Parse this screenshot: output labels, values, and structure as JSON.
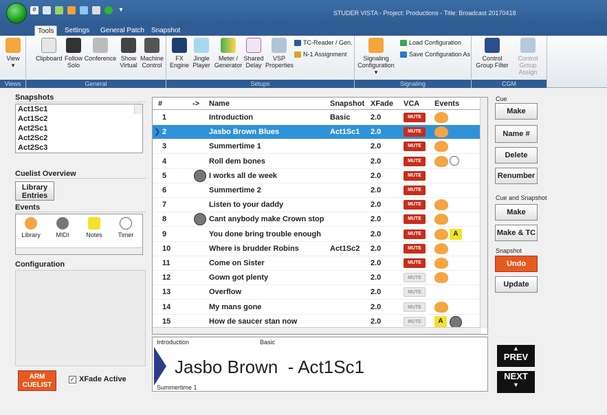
{
  "window": {
    "title": "STUDER VISTA - Project: Productions - Title: Broadcast 20170418"
  },
  "tabs": [
    "Tools",
    "Settings",
    "General Patch",
    "Snapshot"
  ],
  "ribbon": {
    "groups": [
      "Views",
      "General",
      "Setups",
      "Signaling",
      "CGM"
    ],
    "view": "View",
    "clipboard": "Clipboard",
    "follow_solo": "Follow Solo",
    "conference": "Conference",
    "show_virtual": "Show Virtual",
    "machine_control": "Machine Control",
    "fx_engine": "FX Engine",
    "jingle_player": "Jingle Player",
    "meter_generator": "Meter / Generator",
    "shared_delay": "Shared Delay",
    "vsp_properties": "VSP Properties",
    "tc_reader": "TC-Reader / Gen.",
    "n1_assignment": "N-1 Assignment",
    "signaling_configuration": "Signaling Configuration",
    "load_configuration": "Load Configuration",
    "save_configuration_as": "Save Configuration As",
    "control_group_filter": "Control Group Filter",
    "control_group_assign": "Control Group Assign"
  },
  "left": {
    "snapshots_title": "Snapshots",
    "snapshots": [
      "Act1Sc1",
      "Act1Sc2",
      "Act2Sc1",
      "Act2Sc2",
      "Act2Sc3"
    ],
    "cuelist_overview_title": "Cuelist Overview",
    "library_entries": "Library Entries",
    "events_title": "Events",
    "events": [
      {
        "label": "Library",
        "icon": "mask-icon"
      },
      {
        "label": "MIDI",
        "icon": "midi-icon"
      },
      {
        "label": "Notes",
        "icon": "notes-icon"
      },
      {
        "label": "Timer",
        "icon": "timer-icon"
      }
    ],
    "configuration_title": "Configuration",
    "arm_cuelist": "ARM CUELIST",
    "xfade_active": "XFade Active"
  },
  "grid": {
    "headers": {
      "num": "#",
      "arrow": "->",
      "name": "Name",
      "snapshot": "Snapshot",
      "xfade": "XFade",
      "vca": "VCA",
      "events": "Events"
    },
    "vca_text": "MUTE",
    "rows": [
      {
        "num": "1",
        "name": "Introduction",
        "snapshot": "Basic",
        "xfade": "2.0",
        "vca": "on",
        "events": [
          "mask"
        ],
        "midi_before": false,
        "selected": false
      },
      {
        "num": "2",
        "name": "Jasbo Brown Blues",
        "snapshot": "Act1Sc1",
        "xfade": "2.0",
        "vca": "on",
        "events": [
          "mask"
        ],
        "midi_before": false,
        "selected": true
      },
      {
        "num": "3",
        "name": "Summertime 1",
        "snapshot": "",
        "xfade": "2.0",
        "vca": "on",
        "events": [
          "mask"
        ],
        "midi_before": false,
        "selected": false
      },
      {
        "num": "4",
        "name": "Roll dem bones",
        "snapshot": "",
        "xfade": "2.0",
        "vca": "on",
        "events": [
          "mask",
          "timer"
        ],
        "midi_before": false,
        "selected": false
      },
      {
        "num": "5",
        "name": "I works all de week",
        "snapshot": "",
        "xfade": "2.0",
        "vca": "on",
        "events": [],
        "midi_before": true,
        "selected": false
      },
      {
        "num": "6",
        "name": "Summertime 2",
        "snapshot": "",
        "xfade": "2.0",
        "vca": "on",
        "events": [],
        "midi_before": false,
        "selected": false
      },
      {
        "num": "7",
        "name": "Listen to your daddy",
        "snapshot": "",
        "xfade": "2.0",
        "vca": "on",
        "events": [
          "mask"
        ],
        "midi_before": false,
        "selected": false
      },
      {
        "num": "8",
        "name": "Cant anybody make Crown stop",
        "snapshot": "",
        "xfade": "2.0",
        "vca": "on",
        "events": [
          "mask"
        ],
        "midi_before": true,
        "selected": false
      },
      {
        "num": "9",
        "name": "You done bring trouble enough",
        "snapshot": "",
        "xfade": "2.0",
        "vca": "on",
        "events": [
          "mask",
          "notes"
        ],
        "midi_before": false,
        "selected": false
      },
      {
        "num": "10",
        "name": "Where is brudder Robins",
        "snapshot": "Act1Sc2",
        "xfade": "2.0",
        "vca": "on",
        "events": [
          "mask"
        ],
        "midi_before": false,
        "selected": false
      },
      {
        "num": "11",
        "name": "Come on Sister",
        "snapshot": "",
        "xfade": "2.0",
        "vca": "on",
        "events": [
          "mask"
        ],
        "midi_before": false,
        "selected": false
      },
      {
        "num": "12",
        "name": "Gown got plenty",
        "snapshot": "",
        "xfade": "2.0",
        "vca": "off",
        "events": [
          "mask"
        ],
        "midi_before": false,
        "selected": false
      },
      {
        "num": "13",
        "name": "Overflow",
        "snapshot": "",
        "xfade": "2.0",
        "vca": "off",
        "events": [],
        "midi_before": false,
        "selected": false
      },
      {
        "num": "14",
        "name": "My mans gone",
        "snapshot": "",
        "xfade": "2.0",
        "vca": "off",
        "events": [
          "mask"
        ],
        "midi_before": false,
        "selected": false
      },
      {
        "num": "15",
        "name": "How de saucer stan now",
        "snapshot": "",
        "xfade": "2.0",
        "vca": "off",
        "events": [
          "notes",
          "midi"
        ],
        "midi_before": false,
        "selected": false
      }
    ]
  },
  "preview": {
    "prev_label": "Introduction",
    "prev_snapshot": "Basic",
    "current": "Jasbo Brown  - Act1Sc1",
    "next_label": "Summertime 1"
  },
  "right": {
    "cue_title": "Cue",
    "make": "Make",
    "name_num": "Name #",
    "delete": "Delete",
    "renumber": "Renumber",
    "cue_and_snapshot_title": "Cue and Snapshot",
    "make2": "Make",
    "make_tc": "Make & TC",
    "snapshot_title": "Snapshot",
    "undo": "Undo",
    "update": "Update",
    "prev": "PREV",
    "next": "NEXT"
  },
  "colors": {
    "accent": "#2f5c93",
    "selection": "#2f92d8",
    "alert": "#e65a1f",
    "mute": "#c62e1c"
  }
}
